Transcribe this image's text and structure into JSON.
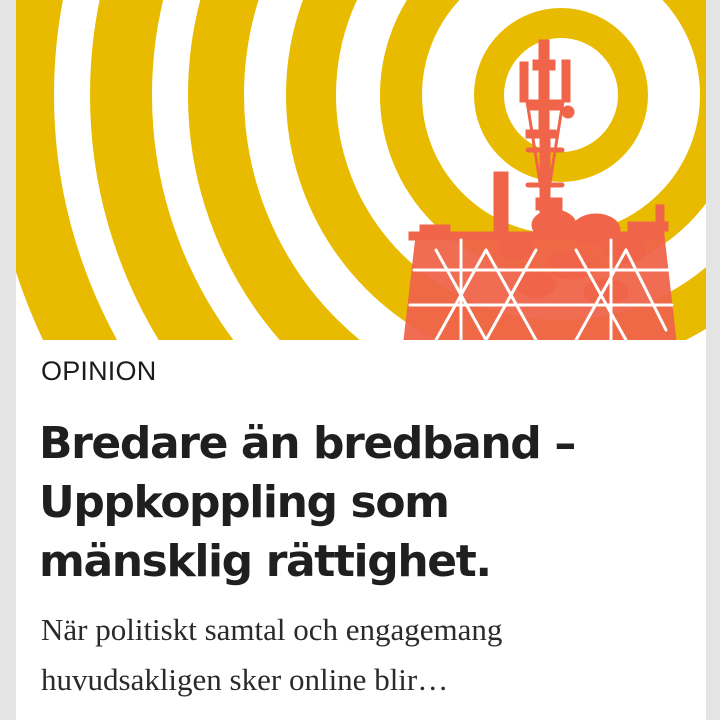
{
  "article": {
    "section": "OPINION",
    "headline": "Bredare än bredband – Uppkoppling som mänsklig rättighet.",
    "lede": "När politiskt samtal och engagemang huvudsakligen sker online blir…",
    "image": {
      "subject": "antenna-tower-with-signal-rings",
      "colors": {
        "rings": "#e8bb00",
        "tower": "#f0654a",
        "background": "#ffffff"
      }
    }
  }
}
